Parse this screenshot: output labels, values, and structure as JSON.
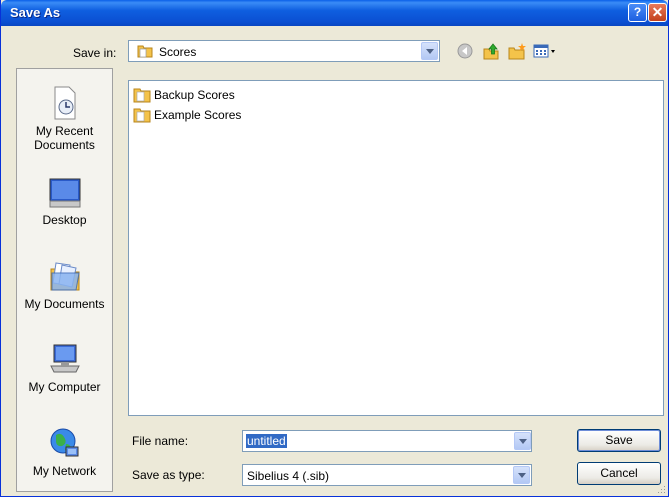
{
  "window": {
    "title": "Save As",
    "help_label": "?",
    "close_label": "✕"
  },
  "save_in": {
    "label": "Save in:",
    "value": "Scores"
  },
  "toolbar": {
    "icons": [
      "back-icon",
      "up-folder-icon",
      "new-folder-icon",
      "views-menu-icon"
    ]
  },
  "places": [
    {
      "label_line1": "My Recent",
      "label_line2": "Documents",
      "icon": "recent-documents-icon"
    },
    {
      "label_line1": "Desktop",
      "label_line2": "",
      "icon": "desktop-icon"
    },
    {
      "label_line1": "My Documents",
      "label_line2": "",
      "icon": "my-documents-icon"
    },
    {
      "label_line1": "My Computer",
      "label_line2": "",
      "icon": "my-computer-icon"
    },
    {
      "label_line1": "My Network",
      "label_line2": "",
      "icon": "my-network-icon"
    }
  ],
  "files": [
    {
      "name": "Backup Scores",
      "type": "folder"
    },
    {
      "name": "Example Scores",
      "type": "folder"
    }
  ],
  "file_name": {
    "label": "File name:",
    "value": "untitled"
  },
  "save_as_type": {
    "label": "Save as type:",
    "value": "Sibelius 4 (.sib)"
  },
  "buttons": {
    "save": "Save",
    "cancel": "Cancel"
  },
  "colors": {
    "titlebar": "#0a5fe8",
    "selection": "#316ac5",
    "dialog_bg": "#ece9d8"
  }
}
